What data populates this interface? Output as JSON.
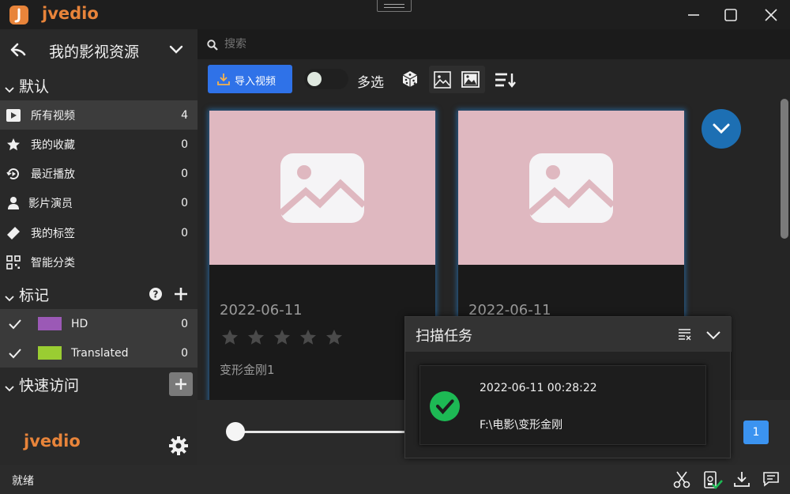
{
  "app": {
    "title": "jvedio"
  },
  "sidebar": {
    "library_name": "我的影视资源",
    "section_default": "默认",
    "items": [
      {
        "label": "所有视频",
        "count": "4"
      },
      {
        "label": "我的收藏",
        "count": "0"
      },
      {
        "label": "最近播放",
        "count": "0"
      },
      {
        "label": "影片演员",
        "count": "0"
      },
      {
        "label": "我的标签",
        "count": "0"
      },
      {
        "label": "智能分类",
        "count": ""
      }
    ],
    "section_marks": "标记",
    "marks": [
      {
        "label": "HD",
        "count": "0",
        "color": "#9b59b6"
      },
      {
        "label": "Translated",
        "count": "0",
        "color": "#9acd32"
      }
    ],
    "section_quick": "快速访问",
    "footer_logo": "jvedio"
  },
  "search": {
    "placeholder": "搜索"
  },
  "toolbar": {
    "import_label": "导入视频",
    "multi_select_label": "多选"
  },
  "cards": [
    {
      "date": "2022-06-11",
      "title": "变形金刚1",
      "rating": 0
    },
    {
      "date": "2022-06-11",
      "title": "",
      "rating": 0
    }
  ],
  "pagination": {
    "current": "1"
  },
  "scan_task": {
    "title": "扫描任务",
    "time": "2022-06-11 00:28:22",
    "path": "F:\\电影\\变形金刚",
    "status": "success"
  },
  "statusbar": {
    "text": "就绪"
  },
  "colors": {
    "accent": "#2f72e8",
    "brand": "#e8843a",
    "success": "#1db954",
    "placeholder_bg": "#dfb8c0"
  }
}
